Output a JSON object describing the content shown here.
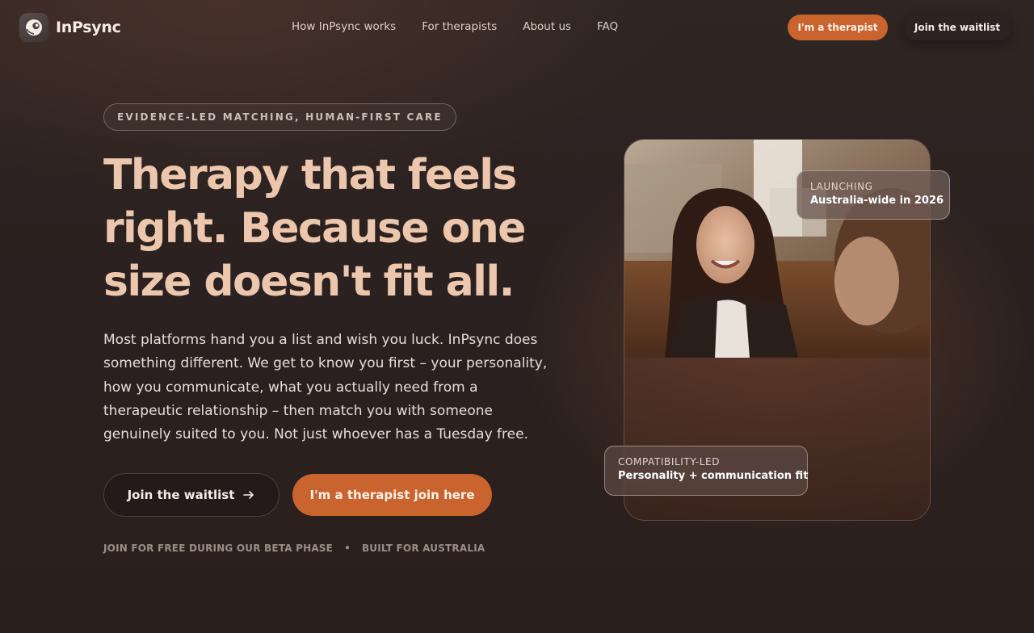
{
  "brand": {
    "name": "InPsync",
    "logo_icon": "swirl-logo-icon"
  },
  "nav": {
    "links": [
      "How InPsync works",
      "For therapists",
      "About us",
      "FAQ"
    ],
    "therapist_button": "I'm a therapist",
    "waitlist_button": "Join the waitlist"
  },
  "hero": {
    "tagline": "EVIDENCE-LED MATCHING, HUMAN-FIRST CARE",
    "headline": "Therapy that feels right. Because one size doesn't fit all.",
    "lede": "Most platforms hand you a list and wish you luck. InPsync does something different. We get to know you first – your personality, how you communicate, what you actually need from a therapeutic relationship – then match you with someone genuinely suited to you. Not just whoever has a Tuesday free.",
    "primary_cta": "Join the waitlist",
    "primary_cta_icon": "arrow-right-icon",
    "secondary_cta": "I'm a therapist join here",
    "footnote_left": "JOIN FOR FREE DURING OUR BETA PHASE",
    "footnote_sep": "•",
    "footnote_right": "BUILT FOR AUSTRALIA"
  },
  "card": {
    "photo": "therapist-smiling-photo",
    "badge_top": {
      "kicker": "LAUNCHING",
      "main": "Australia-wide in 2026"
    },
    "badge_bottom": {
      "kicker": "COMPATIBILITY-LED",
      "main": "Personality + communication fit"
    }
  },
  "colors": {
    "accent": "#c9642f",
    "headline": "#edc7ad",
    "background": "#2a2120"
  }
}
